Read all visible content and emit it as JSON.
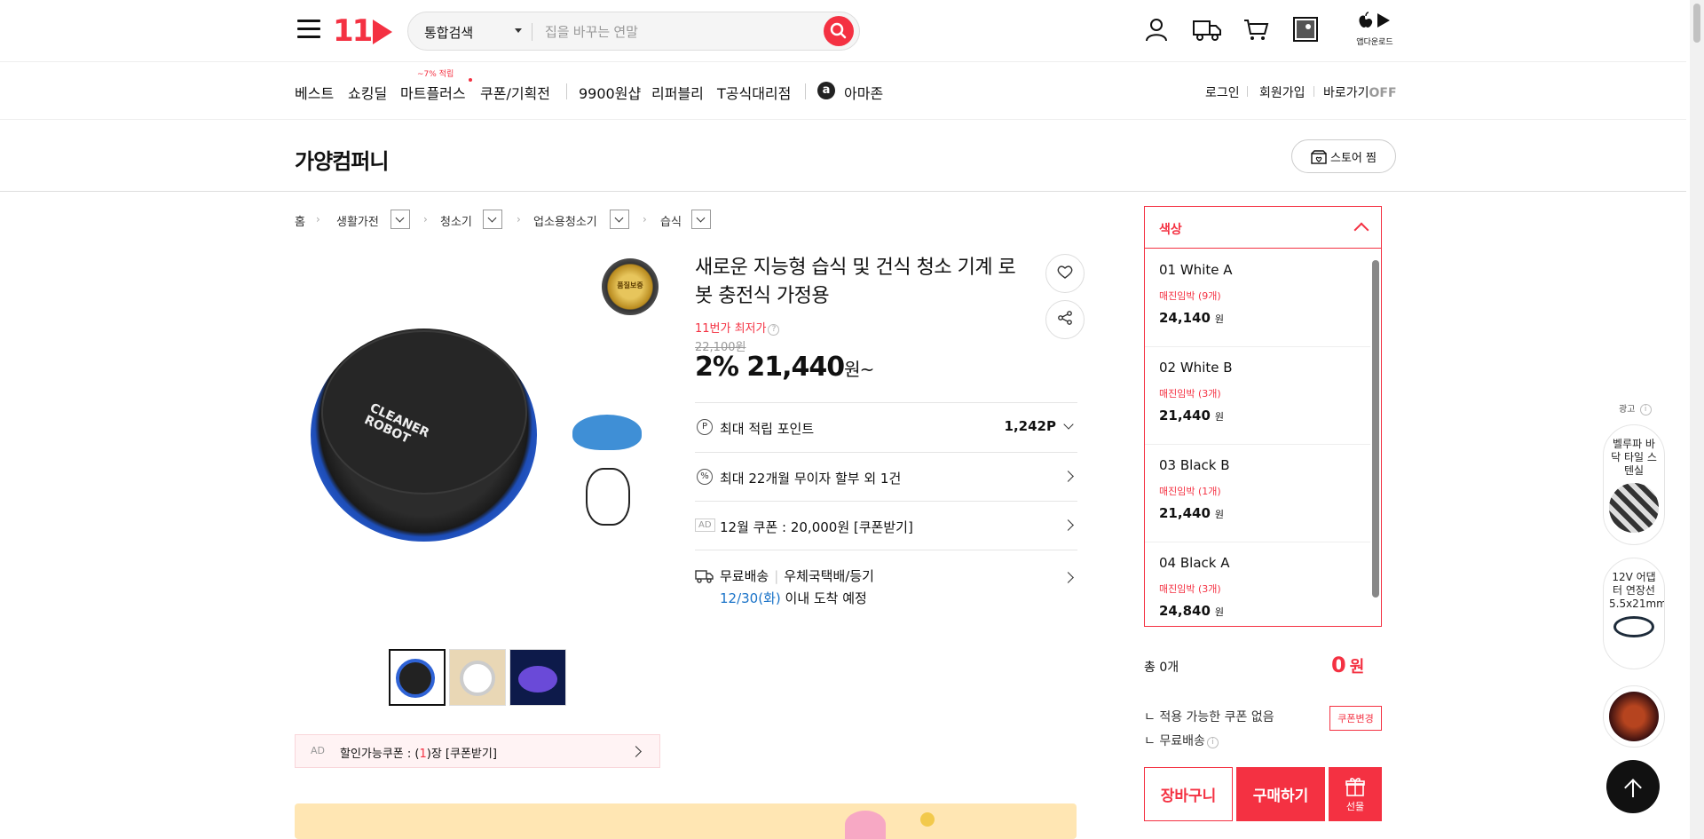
{
  "header": {
    "logo": "11",
    "search_scope": "통합검색",
    "search_placeholder": "집을 바꾸는 연말",
    "app_download": "앱다운로드"
  },
  "nav": {
    "items": [
      "베스트",
      "쇼킹딜",
      "마트플러스",
      "쿠폰/기획전",
      "9900원샵",
      "리퍼블리",
      "T공식대리점",
      "아마존"
    ],
    "mart_badge": "~7% 적립",
    "login": "로그인",
    "signup": "회원가입",
    "shortcut": "바로가기",
    "shortcut_state": "OFF"
  },
  "store": {
    "name": "가양컴퍼니",
    "fav_label": "스토어 찜"
  },
  "breadcrumb": [
    "홈",
    "생활가전",
    "청소기",
    "업소용청소기",
    "습식"
  ],
  "product": {
    "title": "새로운 지능형 습식 및 건식 청소 기계 로봇 충전식 가정용",
    "lowest_label": "11번가 최저가",
    "original_price": "22,100원",
    "discount": "2%",
    "price": "21,440",
    "price_unit": "원~",
    "robot_label": "CLEANER ROBOT",
    "badge_text": "품질보증"
  },
  "info_rows": {
    "points_label": "최대 적립 포인트",
    "points_value": "1,242P",
    "installment": "최대 22개월 무이자 할부 외 1건",
    "ad_tag": "AD",
    "coupon": "12월 쿠폰 : 20,000원 [쿠폰받기]",
    "ship_free": "무료배송",
    "ship_method": "우체국택배/등기",
    "ship_date": "12/30(화)",
    "ship_suffix": "이내 도착 예정"
  },
  "coupon_bar": {
    "ad_tag": "AD",
    "prefix": "할인가능쿠폰 : (",
    "count": "1",
    "suffix": ")장 [쿠폰받기]"
  },
  "options": {
    "header": "색상",
    "items": [
      {
        "name": "01 White A",
        "stock": "매진임박 (9개)",
        "price": "24,140",
        "unit": "원"
      },
      {
        "name": "02 White B",
        "stock": "매진임박 (3개)",
        "price": "21,440",
        "unit": "원"
      },
      {
        "name": "03 Black B",
        "stock": "매진임박 (1개)",
        "price": "21,440",
        "unit": "원"
      },
      {
        "name": "04 Black A",
        "stock": "매진임박 (3개)",
        "price": "24,840",
        "unit": "원"
      }
    ]
  },
  "summary": {
    "total_label": "총 0개",
    "total_value": "0",
    "total_unit": "원",
    "no_coupon": "ㄴ 적용 가능한 쿠폰 없음",
    "free_ship": "ㄴ 무료배송",
    "coupon_change": "쿠폰변경",
    "cart": "장바구니",
    "buy": "구매하기",
    "gift": "선물"
  },
  "side_ads": {
    "label": "광고",
    "items": [
      "벨루파 바닥 타일 스텐실",
      "12V 어댑터 연장선 5.5x21mm"
    ]
  },
  "colors": {
    "accent": "#f43142",
    "link_blue": "#1a73c8"
  }
}
